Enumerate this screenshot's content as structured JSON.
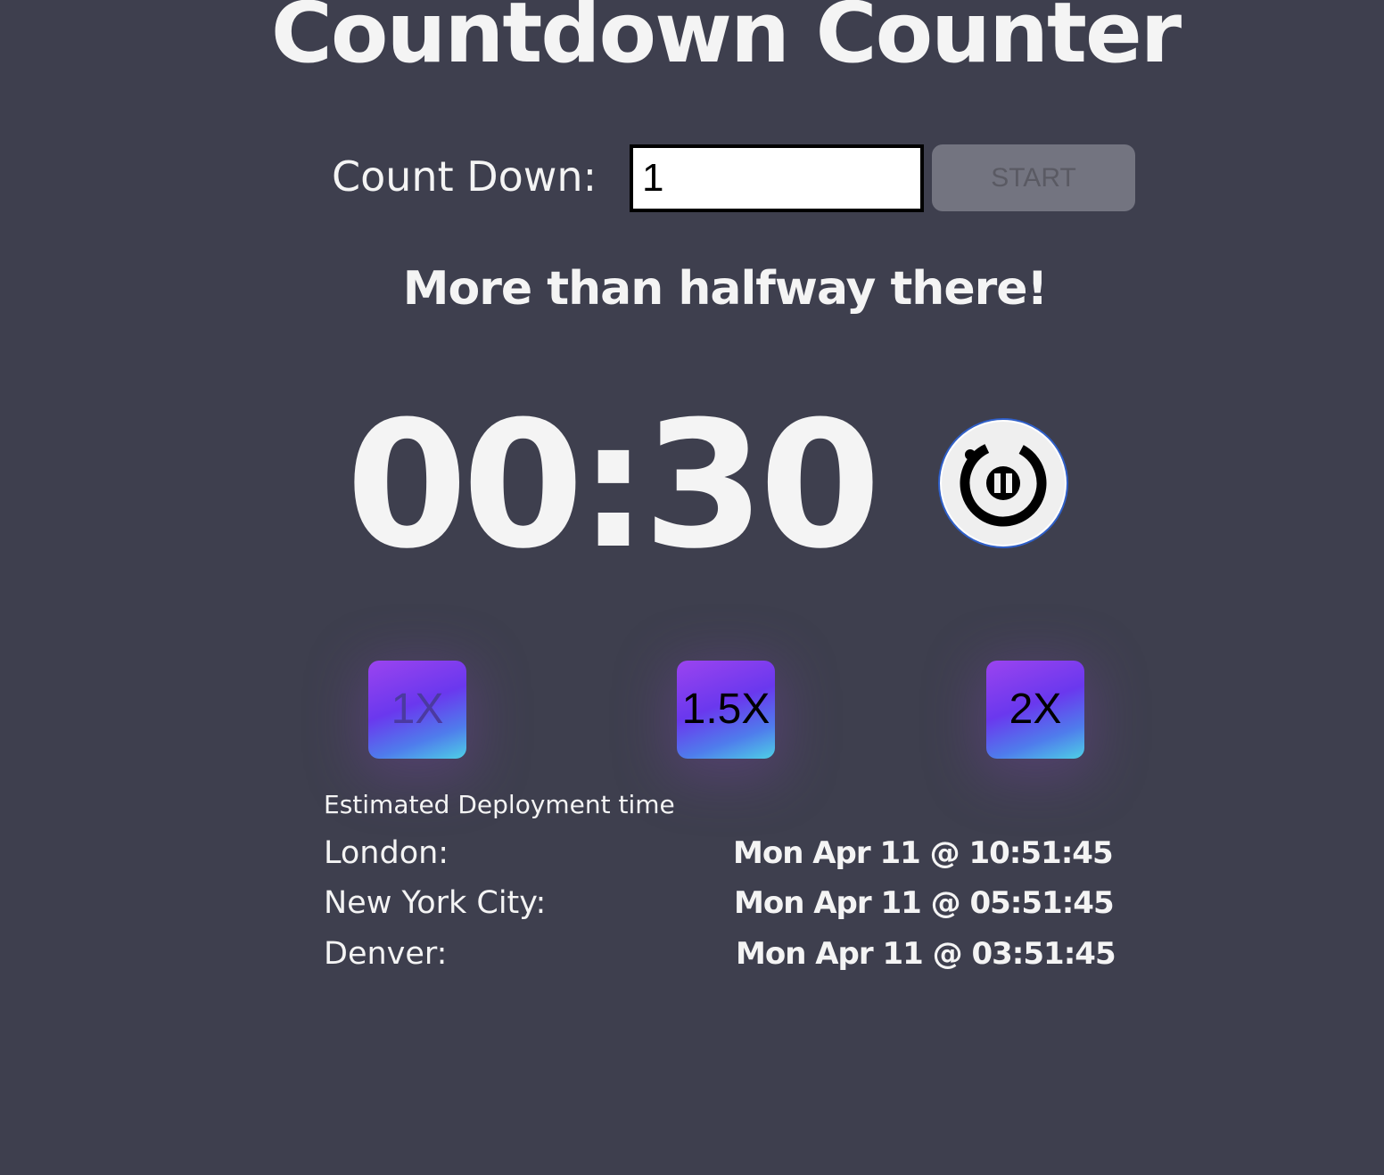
{
  "app": {
    "title": "Countdown Counter"
  },
  "controls": {
    "count_label": "Count Down:",
    "count_value": "1",
    "start_label": "START"
  },
  "status": {
    "message": "More than halfway there!"
  },
  "timer": {
    "display": "00:30",
    "pause_icon": "pause-icon"
  },
  "speeds": [
    {
      "label": "1X",
      "active": true
    },
    {
      "label": "1.5X",
      "active": false
    },
    {
      "label": "2X",
      "active": false
    }
  ],
  "deployment": {
    "title": "Estimated Deployment time",
    "rows": [
      {
        "city": "London:",
        "time": "Mon Apr 11 @ 10:51:45"
      },
      {
        "city": "New York City:",
        "time": "Mon Apr 11 @ 05:51:45"
      },
      {
        "city": "Denver:",
        "time": "Mon Apr 11 @ 03:51:45"
      }
    ]
  },
  "colors": {
    "background": "#3e3f4e",
    "text": "#f3f3f3",
    "start_button": "#737480",
    "pause_ring": "#2f5fc8",
    "gradient_start": "#9b44ef",
    "gradient_end": "#4ed0e6"
  }
}
